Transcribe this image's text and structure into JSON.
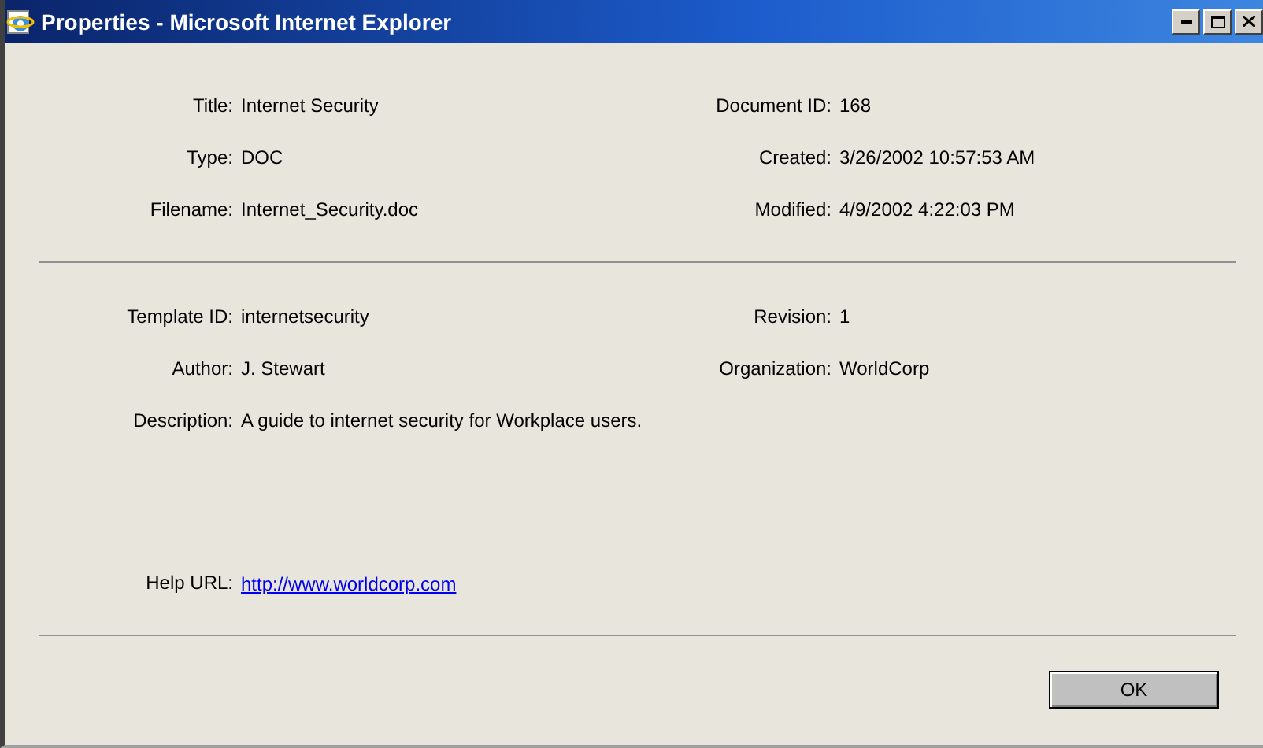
{
  "window": {
    "title": "Properties - Microsoft Internet Explorer"
  },
  "sections": [
    {
      "rows": [
        [
          {
            "label": "Title:",
            "value": "Internet Security",
            "kind": "text"
          },
          {
            "label": "Document ID:",
            "value": "168",
            "kind": "text"
          }
        ],
        [
          {
            "label": "Type:",
            "value": "DOC",
            "kind": "text"
          },
          {
            "label": "Created:",
            "value": "3/26/2002 10:57:53 AM",
            "kind": "text"
          }
        ],
        [
          {
            "label": "Filename:",
            "value": "Internet_Security.doc",
            "kind": "text"
          },
          {
            "label": "Modified:",
            "value": "4/9/2002 4:22:03 PM",
            "kind": "text"
          }
        ]
      ]
    },
    {
      "rows": [
        [
          {
            "label": "Template ID:",
            "value": "internetsecurity",
            "kind": "text"
          },
          {
            "label": "Revision:",
            "value": "1",
            "kind": "text"
          }
        ],
        [
          {
            "label": "Author:",
            "value": "J. Stewart",
            "kind": "text"
          },
          {
            "label": "Organization:",
            "value": "WorldCorp",
            "kind": "text"
          }
        ],
        [
          {
            "label": "Description:",
            "value": "A guide to internet security for Workplace users.",
            "kind": "text"
          }
        ]
      ],
      "footer_rows": [
        [
          {
            "label": "Help URL:",
            "value": "http://www.worldcorp.com",
            "kind": "link"
          }
        ]
      ]
    }
  ],
  "buttons": [
    "OK"
  ]
}
